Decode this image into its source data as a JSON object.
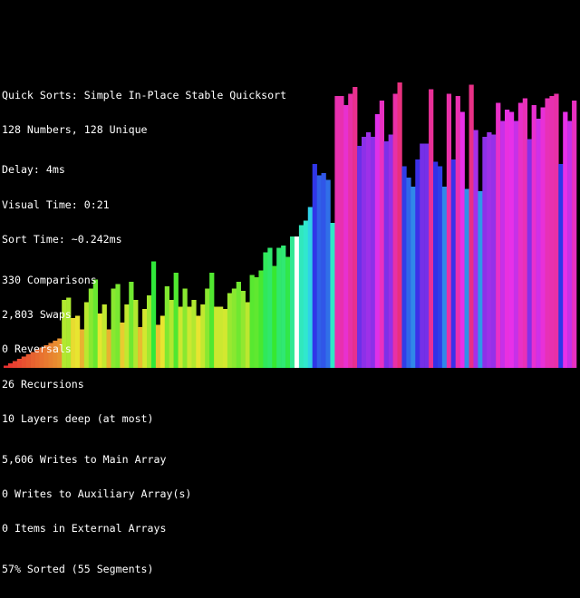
{
  "window": {
    "background": "#000000",
    "text_color": "#ffffff"
  },
  "stats": {
    "title": "Quick Sorts: Simple In-Place Stable Quicksort",
    "counts": "128 Numbers, 128 Unique",
    "delay": "Delay: 4ms",
    "visual_time": "Visual Time: 0:21",
    "sort_time": "Sort Time: ~0.242ms",
    "comparisons": "330 Comparisons",
    "swaps": "2,803 Swaps",
    "reversals": "0 Reversals",
    "recursions": "26 Recursions",
    "layers": "10 Layers deep (at most)",
    "main_writes": "5,606 Writes to Main Array",
    "aux_writes": "0 Writes to Auxiliary Array(s)",
    "external_items": "0 Items in External Arrays",
    "sorted": "57% Sorted (55 Segments)"
  },
  "array": {
    "count": 128,
    "max_value": 128,
    "highlight_color": "#ffffff",
    "values": [
      1,
      2,
      3,
      4,
      5,
      6,
      7,
      8,
      9,
      10,
      11,
      12,
      13,
      30,
      31,
      22,
      23,
      17,
      29,
      35,
      39,
      24,
      28,
      17,
      35,
      37,
      20,
      28,
      38,
      30,
      18,
      26,
      32,
      47,
      19,
      23,
      36,
      30,
      42,
      27,
      35,
      27,
      30,
      23,
      28,
      35,
      42,
      27,
      27,
      26,
      33,
      35,
      38,
      34,
      29,
      41,
      40,
      43,
      51,
      53,
      45,
      53,
      54,
      49,
      58,
      58,
      63,
      65,
      71,
      90,
      85,
      86,
      83,
      64,
      120,
      120,
      116,
      121,
      124,
      98,
      102,
      104,
      102,
      112,
      118,
      100,
      103,
      121,
      126,
      89,
      84,
      80,
      92,
      99,
      99,
      123,
      91,
      89,
      80,
      121,
      92,
      120,
      113,
      79,
      125,
      105,
      78,
      102,
      104,
      103,
      117,
      109,
      114,
      113,
      109,
      117,
      119,
      101,
      116,
      110,
      115,
      119,
      120,
      121,
      90,
      113,
      109,
      118
    ],
    "highlighted_indices": [
      65
    ]
  }
}
